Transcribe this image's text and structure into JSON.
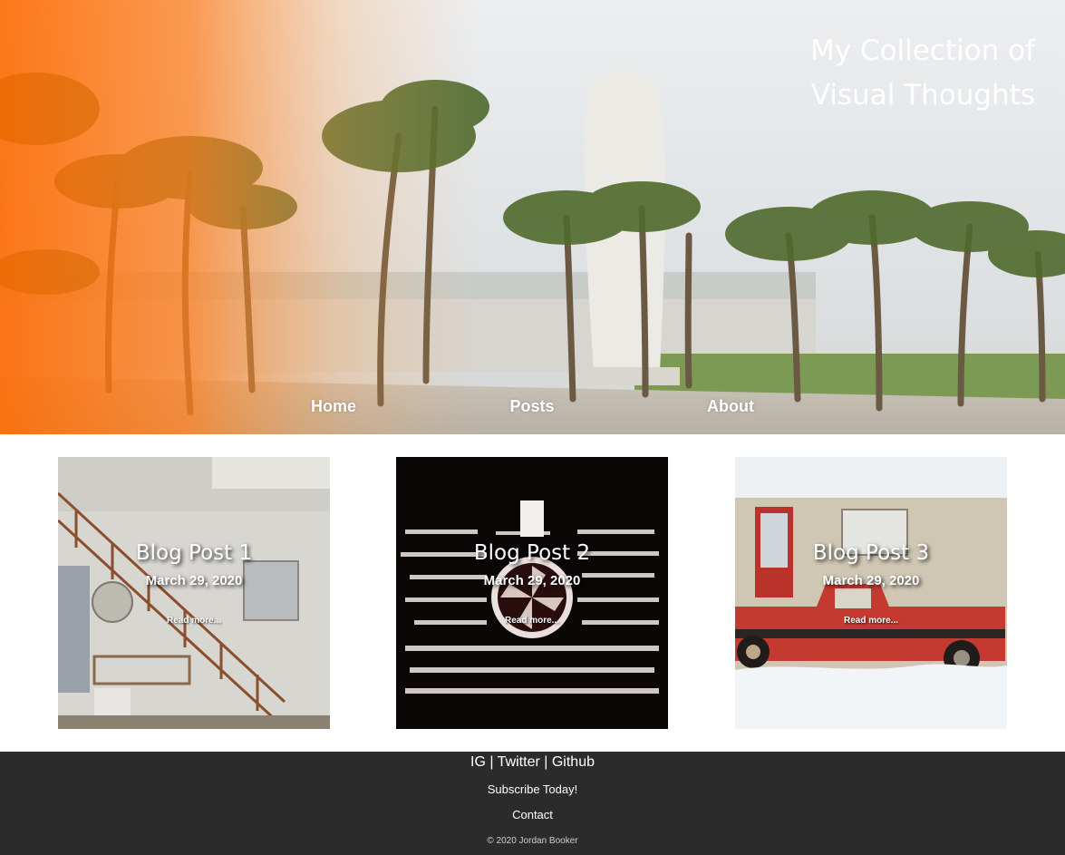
{
  "hero": {
    "title": "My Collection of Visual Thoughts",
    "image_description_icon": "palm-trees-photo",
    "accent_color": "#ff7a1a"
  },
  "nav": {
    "items": [
      {
        "label": "Home"
      },
      {
        "label": "Posts"
      },
      {
        "label": "About"
      }
    ]
  },
  "posts": [
    {
      "title": "Blog Post 1",
      "date": "March 29, 2020",
      "read_more": "Read more..."
    },
    {
      "title": "Blog Post 2",
      "date": "March 29, 2020",
      "read_more": "Read more..."
    },
    {
      "title": "Blog Post 3",
      "date": "March 29, 2020",
      "read_more": "Read more..."
    }
  ],
  "footer": {
    "social": {
      "ig": "IG",
      "sep1": " | ",
      "twitter": "Twitter",
      "sep2": " | ",
      "github": "Github"
    },
    "subscribe": "Subscribe Today!",
    "contact": "Contact",
    "copyright": "© 2020 Jordan Booker",
    "background": "#2b2b2b"
  }
}
